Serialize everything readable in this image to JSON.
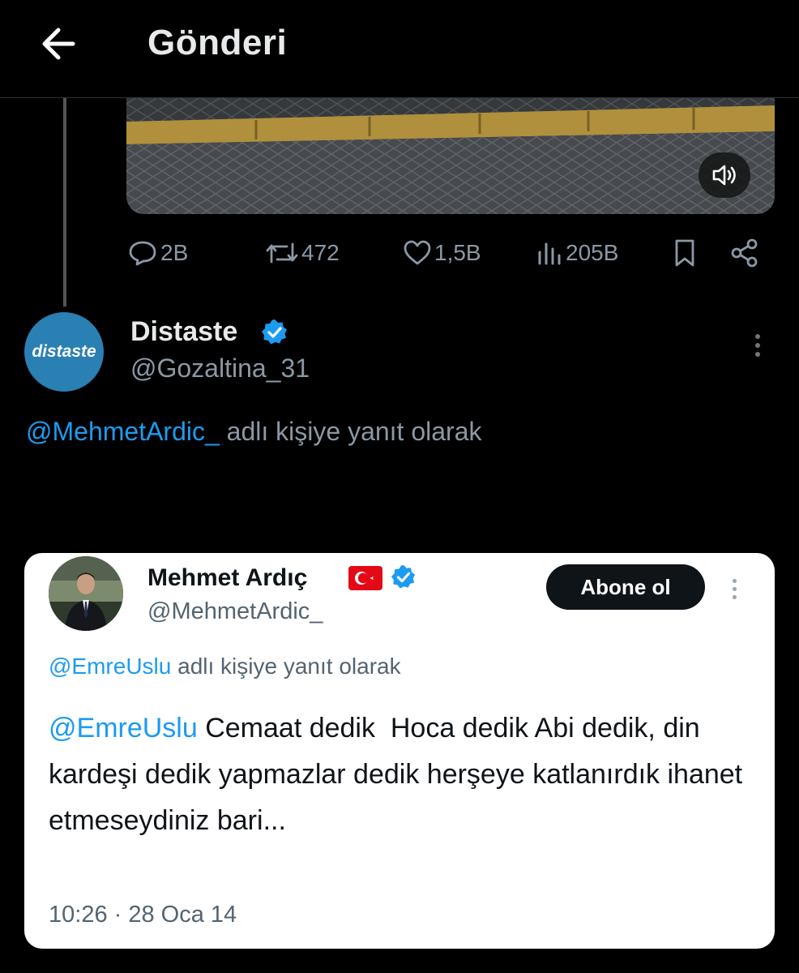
{
  "header": {
    "title": "Gönderi"
  },
  "post_actions": {
    "replies": "2B",
    "reposts": "472",
    "likes": "1,5B",
    "views": "205B"
  },
  "reply_tweet": {
    "avatar_text": "distaste",
    "name": "Distaste",
    "handle": "@Gozaltina_31",
    "reply_to_handle": "@MehmetArdic_",
    "reply_to_suffix": " adlı kişiye yanıt olarak"
  },
  "embedded_tweet": {
    "name": "Mehmet Ardıç",
    "handle": "@MehmetArdic_",
    "follow_label": "Abone ol",
    "reply_to_handle": "@EmreUslu",
    "reply_to_suffix": " adlı kişiye yanıt olarak",
    "text_mention": "@EmreUslu",
    "text_body": " Cemaat dedik  Hoca dedik Abi dedik, din kardeşi dedik yapmazlar dedik herşeye katlanırdık ihanet etmeseydiniz bari...",
    "timestamp": "10:26 · 28 Oca 14"
  },
  "colors": {
    "background": "#000000",
    "link": "#1d9bf0",
    "muted": "#8b98a5",
    "verified": "#1d9bf0",
    "flag_red": "#e30a17"
  },
  "icons": [
    "back-arrow-icon",
    "volume-icon",
    "reply-icon",
    "repost-icon",
    "like-icon",
    "views-icon",
    "bookmark-icon",
    "share-icon",
    "verified-icon",
    "more-icon",
    "turkey-flag-icon"
  ]
}
